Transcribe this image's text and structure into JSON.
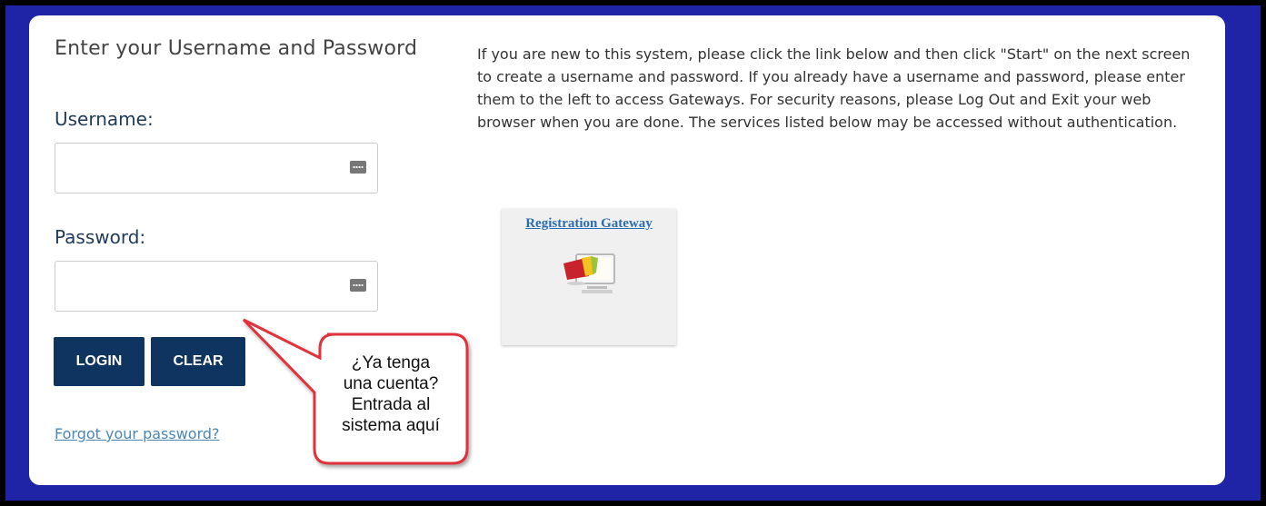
{
  "login": {
    "title": "Enter your Username and Password",
    "username_label": "Username:",
    "password_label": "Password:",
    "username_value": "",
    "password_value": "",
    "login_button": "LOGIN",
    "clear_button": "CLEAR",
    "forgot_link": "Forgot your password?"
  },
  "info": {
    "text": "If you are new to this system, please click the link below and then click \"Start\" on the next screen to create a username and password. If you already have a username and password, please enter them to the left to access Gateways. For security reasons, please Log Out and Exit your web browser when you are done.  The services listed below may be accessed without authentication."
  },
  "gateway": {
    "label": "Registration Gateway",
    "icon": "registration-monitor-icon"
  },
  "callout": {
    "line1": "¿Ya tenga",
    "line2": "una cuenta?",
    "line3": "Entrada al",
    "line4": "sistema aquí"
  },
  "colors": {
    "frame_blue": "#1f23a6",
    "button_navy": "#0f3460",
    "link_blue": "#4b87b5",
    "callout_red": "#e0333c"
  }
}
